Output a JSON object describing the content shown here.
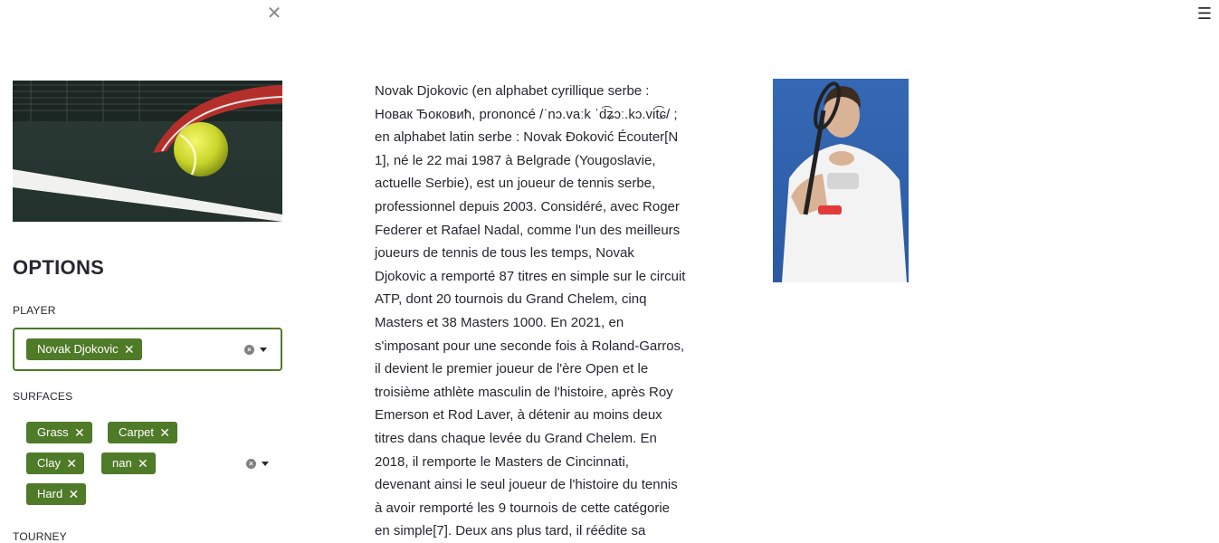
{
  "app": {
    "close_symbol": "✕",
    "menu_symbol": "☰"
  },
  "sidebar": {
    "options_title": "OPTIONS",
    "player": {
      "label": "PLAYER",
      "selected": [
        "Novak Djokovic"
      ]
    },
    "surfaces": {
      "label": "SURFACES",
      "selected": [
        "Grass",
        "Carpet",
        "Clay",
        "nan",
        "Hard"
      ]
    },
    "tourney": {
      "label": "TOURNEY"
    },
    "tag_remove_symbol": "✕",
    "clear_symbol": "×"
  },
  "main": {
    "bio": "Novak Djokovic (en alphabet cyrillique serbe : Новак Ђоковић, prononcé /ˈnɔ.vaːk ˈd͡ʑɔː.kɔ.vit͡ɕ/ ; en alphabet latin serbe : Novak Đoković Écouter[N 1], né le 22 mai 1987 à Belgrade (Yougoslavie, actuelle Serbie), est un joueur de tennis serbe, professionnel depuis 2003. Considéré, avec Roger Federer et Rafael Nadal, comme l'un des meilleurs joueurs de tennis de tous les temps, Novak Djokovic a remporté 87 titres en simple sur le circuit ATP, dont 20 tournois du Grand Chelem, cinq Masters et 38 Masters 1000. En 2021, en s'imposant pour une seconde fois à Roland-Garros, il devient le premier joueur de l'ère Open et le troisième athlète masculin de l'histoire, après Roy Emerson et Rod Laver, à détenir au moins deux titres dans chaque levée du Grand Chelem. En 2018, il remporte le Masters de Cincinnati, devenant ainsi le seul joueur de l'histoire du tennis à avoir remporté les 9 tournois de cette catégorie en simple[7]. Deux ans plus tard, il réédite sa"
  },
  "colors": {
    "accent": "#4f7a28",
    "text": "#262730"
  }
}
